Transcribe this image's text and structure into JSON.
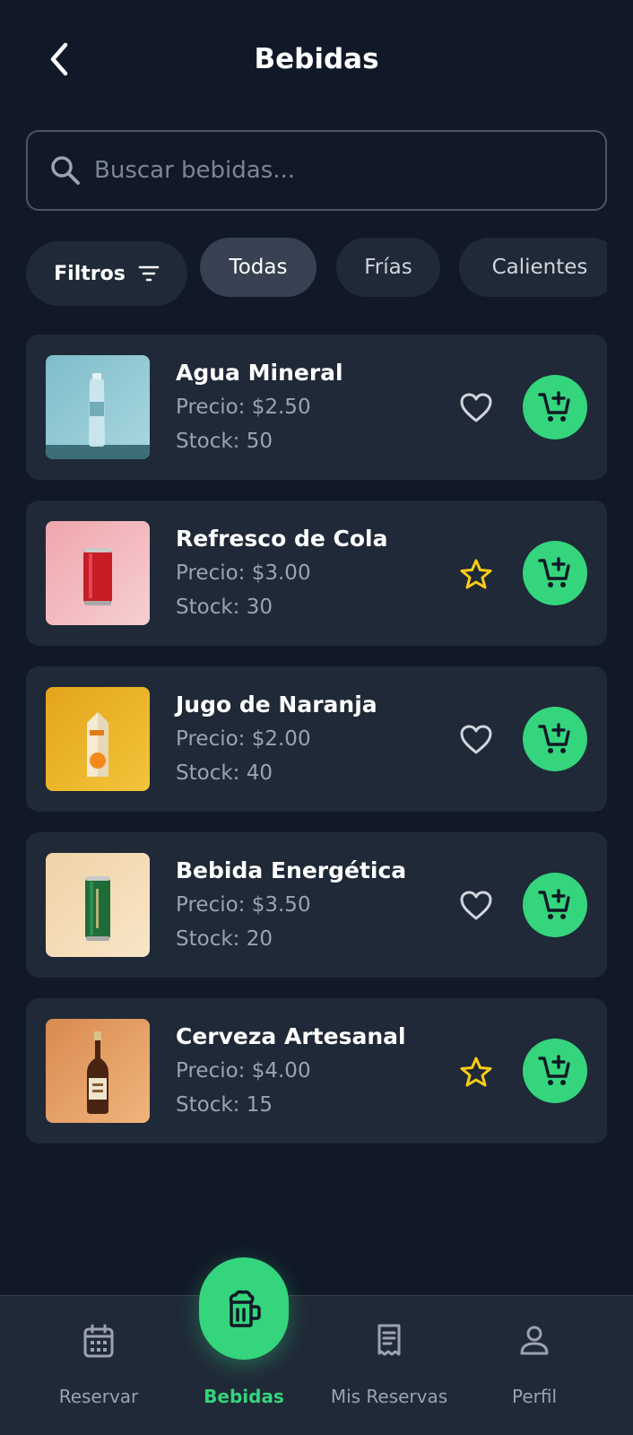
{
  "header": {
    "title": "Bebidas"
  },
  "search": {
    "placeholder": "Buscar bebidas..."
  },
  "filters": {
    "filter_label": "Filtros",
    "chips": [
      "Todas",
      "Frías",
      "Calientes"
    ],
    "selected": "Todas"
  },
  "products": [
    {
      "name": "Agua Mineral",
      "price": "Precio: $2.50",
      "stock": "Stock: 50",
      "fav_icon": "heart-outline-icon"
    },
    {
      "name": "Refresco de Cola",
      "price": "Precio: $3.00",
      "stock": "Stock: 30",
      "fav_icon": "star-outline-icon"
    },
    {
      "name": "Jugo de Naranja",
      "price": "Precio: $2.00",
      "stock": "Stock: 40",
      "fav_icon": "heart-outline-icon"
    },
    {
      "name": "Bebida Energética",
      "price": "Precio: $3.50",
      "stock": "Stock: 20",
      "fav_icon": "heart-outline-icon"
    },
    {
      "name": "Cerveza Artesanal",
      "price": "Precio: $4.00",
      "stock": "Stock: 15",
      "fav_icon": "star-outline-icon"
    }
  ],
  "nav": {
    "items": [
      {
        "label": "Reservar",
        "icon": "calendar-icon"
      },
      {
        "label": "Bebidas",
        "icon": "beer-mug-icon"
      },
      {
        "label": "Mis Reservas",
        "icon": "receipt-icon"
      },
      {
        "label": "Perfil",
        "icon": "person-icon"
      }
    ],
    "active": "Bebidas"
  },
  "colors": {
    "background": "#111827",
    "card": "#1f2937",
    "accent": "#34d57d",
    "star": "#facc15",
    "muted_text": "#9ca3af"
  }
}
